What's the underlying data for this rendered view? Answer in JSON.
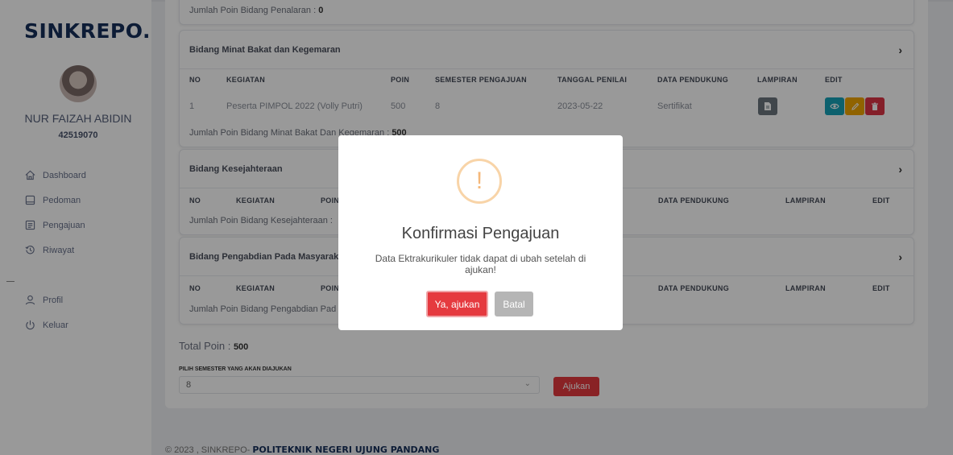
{
  "brand": "SINKREPO.",
  "user": {
    "name": "NUR FAIZAH ABIDIN",
    "id": "42519070"
  },
  "nav_main": [
    {
      "label": "Dashboard",
      "icon": "home-icon"
    },
    {
      "label": "Pedoman",
      "icon": "book-icon"
    },
    {
      "label": "Pengajuan",
      "icon": "form-icon"
    },
    {
      "label": "Riwayat",
      "icon": "history-icon"
    }
  ],
  "nav_user": [
    {
      "label": "Profil",
      "icon": "user-icon"
    },
    {
      "label": "Keluar",
      "icon": "power-icon"
    }
  ],
  "penalaran": {
    "summary_label": "Jumlah Poin Bidang Penalaran",
    "summary_value": "0"
  },
  "minat": {
    "title": "Bidang Minat Bakat dan Kegemaran",
    "headers": [
      "NO",
      "KEGIATAN",
      "POIN",
      "SEMESTER PENGAJUAN",
      "TANGGAL PENILAI",
      "DATA PENDUKUNG",
      "LAMPIRAN",
      "EDIT"
    ],
    "row": {
      "no": "1",
      "kegiatan": "Peserta PIMPOL 2022 (Volly Putri)",
      "poin": "500",
      "semester": "8",
      "tanggal": "2023-05-22",
      "pendukung": "Sertifikat"
    },
    "summary_label": "Jumlah Poin Bidang Minat Bakat Dan Kegemaran",
    "summary_value": "500"
  },
  "kesejahteraan": {
    "title": "Bidang Kesejahteraan",
    "headers": [
      "NO",
      "KEGIATAN",
      "POIN",
      "DATA PENDUKUNG",
      "LAMPIRAN",
      "EDIT"
    ],
    "summary_label": "Jumlah Poin Bidang Kesejahteraan :"
  },
  "pengabdian": {
    "title": "Bidang Pengabdian Pada Masyarak",
    "headers": [
      "NO",
      "KEGIATAN",
      "POIN",
      "DATA PENDUKUNG",
      "LAMPIRAN",
      "EDIT"
    ],
    "summary_label": "Jumlah Poin Bidang Pengabdian Pad"
  },
  "total": {
    "label": "Total Poin",
    "value": "500"
  },
  "semester_select": {
    "label": "PILIH SEMESTER YANG AKAN DIAJUKAN",
    "value": "8"
  },
  "ajukan_label": "Ajukan",
  "footer": {
    "text": "© 2023 , SINKREPO- ",
    "org": "POLITEKNIK NEGERI UJUNG PANDANG"
  },
  "modal": {
    "icon": "!",
    "title": "Konfirmasi Pengajuan",
    "text": "Data Ektrakurikuler tidak dapat di ubah setelah di ajukan!",
    "confirm": "Ya, ajukan",
    "cancel": "Batal"
  },
  "colors": {
    "brand": "#16305b",
    "danger": "#e53a3f",
    "info": "#17a2b8",
    "warning": "#f0a500",
    "secondary": "#6c757d"
  }
}
